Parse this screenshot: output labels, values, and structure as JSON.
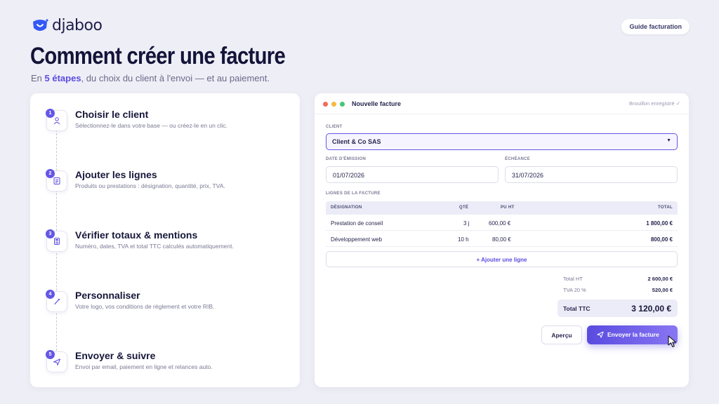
{
  "brand": {
    "name": "djaboo"
  },
  "header": {
    "guide_button": "Guide facturation",
    "title": "Comment créer une facture",
    "subtitle_pre": "En ",
    "subtitle_accent": "5 étapes",
    "subtitle_post": ", du choix du client à l'envoi — et au paiement."
  },
  "steps": [
    {
      "number": "1",
      "icon": "user-icon",
      "title": "Choisir le client",
      "description": "Sélectionnez-le dans votre base — ou créez-le en un clic."
    },
    {
      "number": "2",
      "icon": "list-icon",
      "title": "Ajouter les lignes",
      "description": "Produits ou prestations : désignation, quantité, prix, TVA."
    },
    {
      "number": "3",
      "icon": "calculator-icon",
      "title": "Vérifier totaux & mentions",
      "description": "Numéro, dates, TVA et total TTC calculés automatiquement."
    },
    {
      "number": "4",
      "icon": "brush-icon",
      "title": "Personnaliser",
      "description": "Votre logo, vos conditions de règlement et votre RIB."
    },
    {
      "number": "5",
      "icon": "send-icon",
      "title": "Envoyer & suivre",
      "description": "Envoi par email, paiement en ligne et relances auto."
    }
  ],
  "invoice": {
    "window_title": "Nouvelle facture",
    "status": "Brouillon enregistré ✓",
    "client_label": "Client",
    "client_value": "Client & Co SAS",
    "issue_date_label": "Date d'émission",
    "issue_date_value": "01/07/2026",
    "due_date_label": "Échéance",
    "due_date_value": "31/07/2026",
    "lines_label": "Lignes de la facture",
    "columns": {
      "designation": "DÉSIGNATION",
      "qty": "QTÉ",
      "unit_price": "PU HT",
      "total": "TOTAL"
    },
    "rows": [
      {
        "designation": "Prestation de conseil",
        "qty": "3 j",
        "unit_price": "600,00 €",
        "total": "1 800,00 €"
      },
      {
        "designation": "Développement web",
        "qty": "10 h",
        "unit_price": "80,00 €",
        "total": "800,00 €"
      }
    ],
    "add_line": "+ Ajouter une ligne",
    "total_ht_label": "Total HT",
    "total_ht_value": "2 600,00 €",
    "tva_label": "TVA 20 %",
    "tva_value": "520,00 €",
    "total_ttc_label": "Total TTC",
    "total_ttc_value": "3 120,00 €",
    "preview_button": "Aperçu",
    "send_button": "Envoyer la facture"
  },
  "colors": {
    "accent": "#6456e6",
    "background": "#eeeef6",
    "dot_red": "#f26b5b",
    "dot_yellow": "#f5b942",
    "dot_green": "#48c774"
  }
}
